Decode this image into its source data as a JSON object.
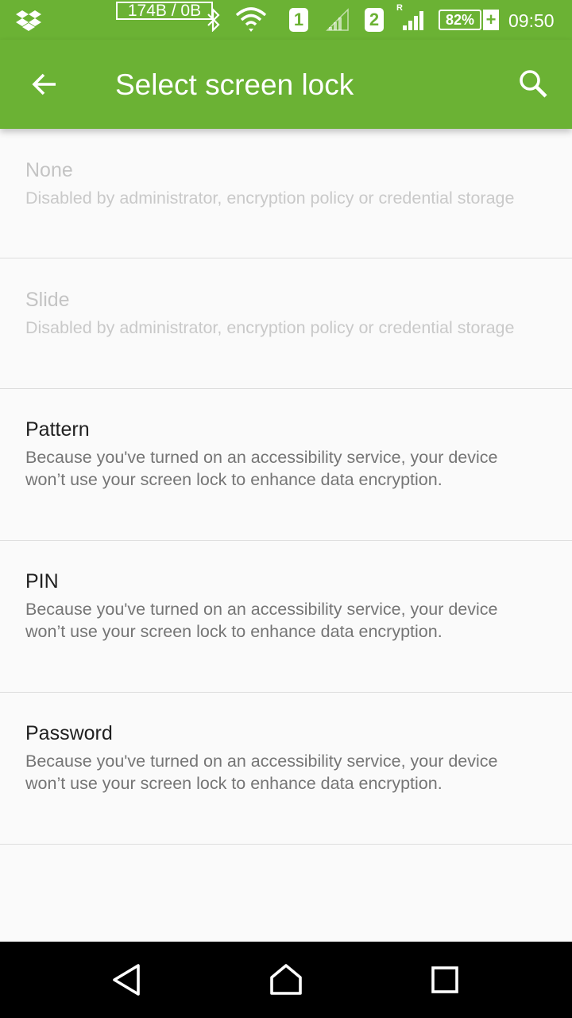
{
  "status_bar": {
    "net_speed": "174B / 0B",
    "sim1": "1",
    "sim2": "2",
    "roaming": "R",
    "battery": "82%",
    "battery_plus": "+",
    "time": "09:50",
    "icons": [
      "dropbox-icon",
      "bluetooth-icon",
      "wifi-icon",
      "signal-icon",
      "battery-icon"
    ]
  },
  "toolbar": {
    "title": "Select screen lock",
    "back_icon": "arrow-back-icon",
    "search_icon": "search-icon",
    "color": "#6bb234"
  },
  "options": [
    {
      "title": "None",
      "summary": "Disabled by administrator, encryption policy or credential storage",
      "enabled": false
    },
    {
      "title": "Slide",
      "summary": "Disabled by administrator, encryption policy or credential storage",
      "enabled": false
    },
    {
      "title": "Pattern",
      "summary": "Because you've turned on an accessibility service, your device won’t use your screen lock to enhance data encryption.",
      "enabled": true
    },
    {
      "title": "PIN",
      "summary": "Because you've turned on an accessibility service, your device won’t use your screen lock to enhance data encryption.",
      "enabled": true
    },
    {
      "title": "Password",
      "summary": "Because you've turned on an accessibility service, your device won’t use your screen lock to enhance data encryption.",
      "enabled": true
    }
  ],
  "nav_bar": {
    "back": "nav-back-icon",
    "home": "nav-home-icon",
    "recents": "nav-recents-icon"
  }
}
